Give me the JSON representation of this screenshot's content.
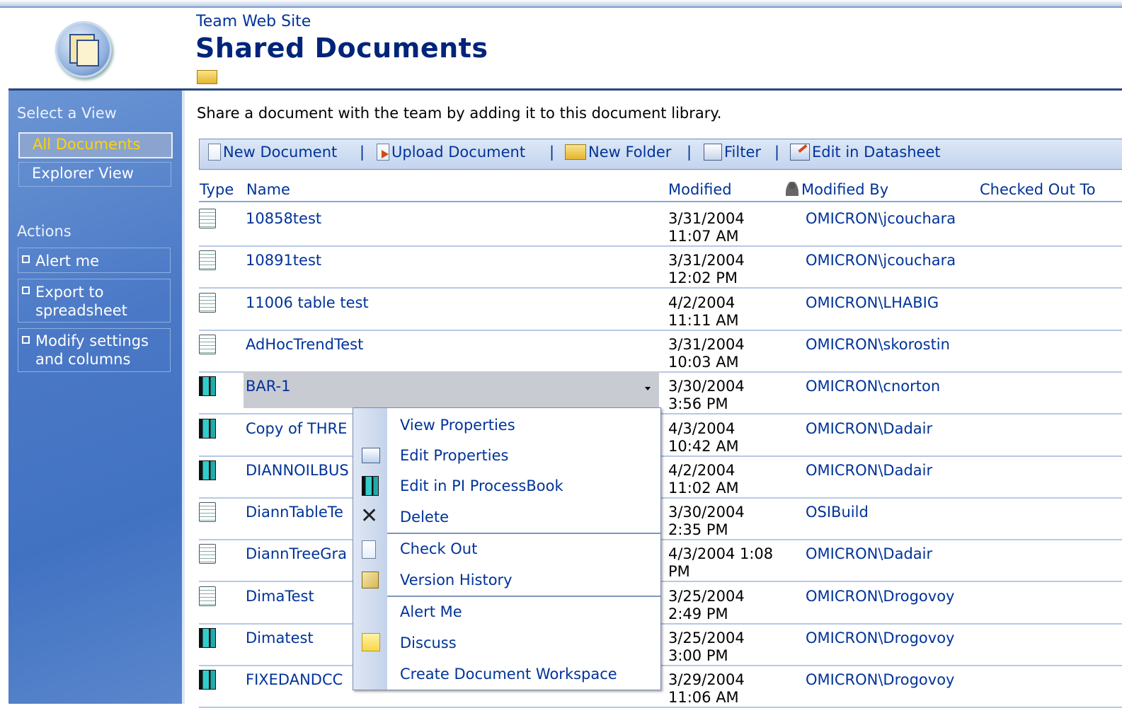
{
  "header": {
    "site_name": "Team Web Site",
    "page_title": "Shared Documents"
  },
  "sidebar": {
    "views_heading": "Select a View",
    "views": [
      {
        "label": "All Documents",
        "selected": true
      },
      {
        "label": "Explorer View",
        "selected": false
      }
    ],
    "actions_heading": "Actions",
    "actions": [
      {
        "label": "Alert me"
      },
      {
        "label": "Export to spreadsheet"
      },
      {
        "label": "Modify settings and columns"
      }
    ]
  },
  "intro": "Share a document with the team by adding it to this document library.",
  "toolbar": {
    "new_document": "New Document",
    "upload_document": "Upload Document",
    "new_folder": "New Folder",
    "filter": "Filter",
    "edit_datasheet": "Edit in Datasheet",
    "separator": "|"
  },
  "columns": {
    "type": "Type",
    "name": "Name",
    "modified": "Modified",
    "modified_by": "Modified By",
    "checked_out_to": "Checked Out To"
  },
  "rows": [
    {
      "type": "grid",
      "name": "10858test",
      "modified": [
        "3/31/2004",
        "11:07 AM"
      ],
      "by": "OMICRON\\jcouchara"
    },
    {
      "type": "grid",
      "name": "10891test",
      "modified": [
        "3/31/2004",
        "12:02 PM"
      ],
      "by": "OMICRON\\jcouchara"
    },
    {
      "type": "grid",
      "name": "11006 table test",
      "modified": [
        "4/2/2004",
        "11:11 AM"
      ],
      "by": "OMICRON\\LHABIG"
    },
    {
      "type": "grid",
      "name": "AdHocTrendTest",
      "modified": [
        "3/31/2004",
        "10:03 AM"
      ],
      "by": "OMICRON\\skorostin"
    },
    {
      "type": "pb",
      "name": "BAR-1",
      "modified": [
        "3/30/2004",
        "3:56 PM"
      ],
      "by": "OMICRON\\cnorton",
      "highlighted": true
    },
    {
      "type": "pb",
      "name": "Copy of THRE",
      "modified": [
        "4/3/2004",
        "10:42 AM"
      ],
      "by": "OMICRON\\Dadair"
    },
    {
      "type": "pb",
      "name": "DIANNOILBUS",
      "modified": [
        "4/2/2004",
        "11:02 AM"
      ],
      "by": "OMICRON\\Dadair"
    },
    {
      "type": "grid",
      "name": "DiannTableTe",
      "modified": [
        "3/30/2004",
        "2:35 PM"
      ],
      "by": "OSIBuild"
    },
    {
      "type": "grid",
      "name": "DiannTreeGra",
      "modified": [
        "4/3/2004 1:08",
        "PM"
      ],
      "by": "OMICRON\\Dadair"
    },
    {
      "type": "grid",
      "name": "DimaTest",
      "modified": [
        "3/25/2004",
        "2:49 PM"
      ],
      "by": "OMICRON\\Drogovoy"
    },
    {
      "type": "pb",
      "name": "Dimatest",
      "modified": [
        "3/25/2004",
        "3:00 PM"
      ],
      "by": "OMICRON\\Drogovoy"
    },
    {
      "type": "pb",
      "name": "FIXEDANDCC",
      "modified": [
        "3/29/2004",
        "11:06 AM"
      ],
      "by": "OMICRON\\Drogovoy"
    }
  ],
  "context_menu": [
    {
      "label": "View Properties",
      "icon": "none"
    },
    {
      "label": "Edit Properties",
      "icon": "edit-properties-icon"
    },
    {
      "label": "Edit in PI ProcessBook",
      "icon": "processbook-icon"
    },
    {
      "label": "Delete",
      "icon": "delete-x-icon"
    },
    {
      "label": "Check Out",
      "icon": "check-out-icon"
    },
    {
      "label": "Version History",
      "icon": "version-history-icon"
    },
    {
      "label": "Alert Me",
      "icon": "none"
    },
    {
      "label": "Discuss",
      "icon": "discuss-note-icon"
    },
    {
      "label": "Create Document Workspace",
      "icon": "none"
    }
  ],
  "delete_glyph": "✕"
}
